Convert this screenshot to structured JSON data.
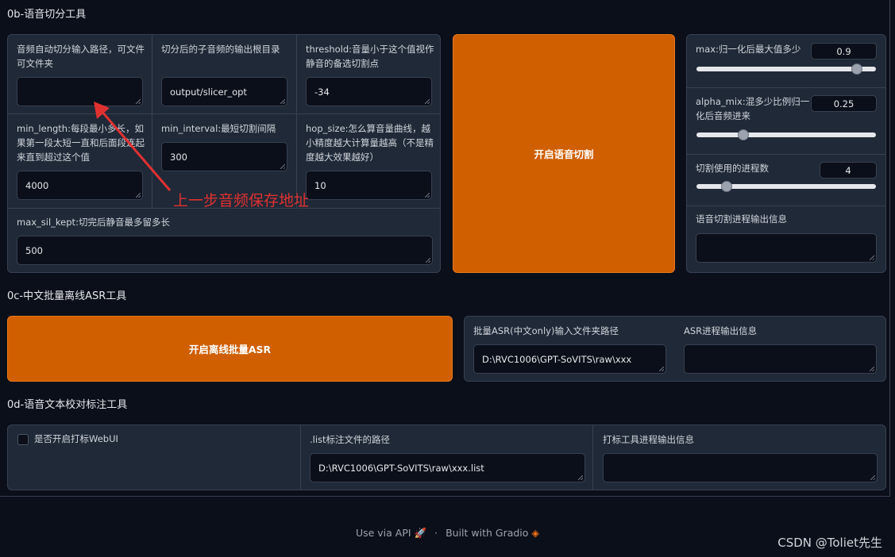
{
  "sections": {
    "slicer_title": "0b-语音切分工具",
    "asr_title": "0c-中文批量离线ASR工具",
    "label_title": "0d-语音文本校对标注工具"
  },
  "slicer": {
    "input_path_label": "音频自动切分输入路径，可文件可文件夹",
    "input_path_value": "",
    "output_root_label": "切分后的子音频的输出根目录",
    "output_root_value": "output/slicer_opt",
    "threshold_label": "threshold:音量小于这个值视作静音的备选切割点",
    "threshold_value": "-34",
    "min_length_label": "min_length:每段最小多长，如果第一段太短一直和后面段连起来直到超过这个值",
    "min_length_value": "4000",
    "min_interval_label": "min_interval:最短切割间隔",
    "min_interval_value": "300",
    "hop_size_label": "hop_size:怎么算音量曲线，越小精度越大计算量越高（不是精度越大效果越好）",
    "hop_size_value": "10",
    "max_sil_kept_label": "max_sil_kept:切完后静音最多留多长",
    "max_sil_kept_value": "500",
    "start_button": "开启语音切割",
    "max_label": "max:归一化后最大值多少",
    "max_value": "0.9",
    "max_level": 0.9,
    "alpha_label": "alpha_mix:混多少比例归一化后音频进来",
    "alpha_value": "0.25",
    "alpha_level": 0.25,
    "procs_label": "切割使用的进程数",
    "procs_value": "4",
    "procs_level": 0.17,
    "output_info_label": "语音切割进程输出信息",
    "output_info_value": ""
  },
  "asr": {
    "start_button": "开启离线批量ASR",
    "input_label": "批量ASR(中文only)输入文件夹路径",
    "input_value": "D:\\RVC1006\\GPT-SoVITS\\raw\\xxx",
    "output_info_label": "ASR进程输出信息",
    "output_info_value": ""
  },
  "labeling": {
    "webui_checkbox_label": "是否开启打标WebUI",
    "webui_checked": false,
    "list_path_label": ".list标注文件的路径",
    "list_path_value": "D:\\RVC1006\\GPT-SoVITS\\raw\\xxx.list",
    "output_info_label": "打标工具进程输出信息",
    "output_info_value": ""
  },
  "annotation": {
    "text": "上一步音频保存地址",
    "color": "#e03131"
  },
  "footer": {
    "api_link": "Use via API",
    "separator": "·",
    "built_with": "Built with Gradio"
  },
  "watermark": "CSDN @Toliet先生",
  "colors": {
    "background": "#0b0f19",
    "panel": "#1f2937",
    "accent_orange": "#d05f00"
  }
}
